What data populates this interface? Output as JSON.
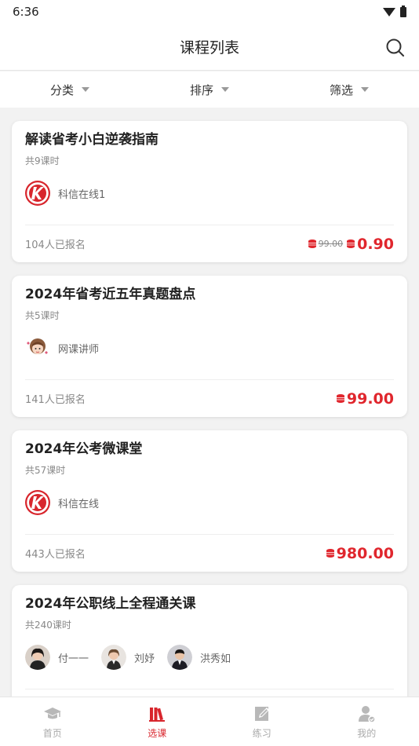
{
  "status": {
    "time": "6:36"
  },
  "header": {
    "title": "课程列表"
  },
  "filters": [
    {
      "label": "分类"
    },
    {
      "label": "排序"
    },
    {
      "label": "筛选"
    }
  ],
  "courses": [
    {
      "title": "解读省考小白逆袭指南",
      "lessons": "共9课时",
      "teachers": [
        {
          "name": "科信在线1",
          "avatar": "kexin-logo"
        }
      ],
      "enrolled": "104人已报名",
      "old_price": "99.00",
      "price": "0.90"
    },
    {
      "title": "2024年省考近五年真题盘点",
      "lessons": "共5课时",
      "teachers": [
        {
          "name": "网课讲师",
          "avatar": "cartoon-girl"
        }
      ],
      "enrolled": "141人已报名",
      "price": "99.00"
    },
    {
      "title": "2024年公考微课堂",
      "lessons": "共57课时",
      "teachers": [
        {
          "name": "科信在线",
          "avatar": "kexin-logo"
        }
      ],
      "enrolled": "443人已报名",
      "price": "980.00"
    },
    {
      "title": "2024年公职线上全程通关课",
      "lessons": "共240课时",
      "teachers": [
        {
          "name": "付一一",
          "avatar": "photo"
        },
        {
          "name": "刘妤",
          "avatar": "photo"
        },
        {
          "name": "洪秀如",
          "avatar": "photo"
        }
      ]
    }
  ],
  "tabs": [
    {
      "label": "首页",
      "icon": "graduation-cap-icon",
      "active": false
    },
    {
      "label": "选课",
      "icon": "books-icon",
      "active": true
    },
    {
      "label": "练习",
      "icon": "edit-icon",
      "active": false
    },
    {
      "label": "我的",
      "icon": "user-icon",
      "active": false
    }
  ],
  "colors": {
    "accent": "#e0262d",
    "tab_active": "#d8262d"
  }
}
